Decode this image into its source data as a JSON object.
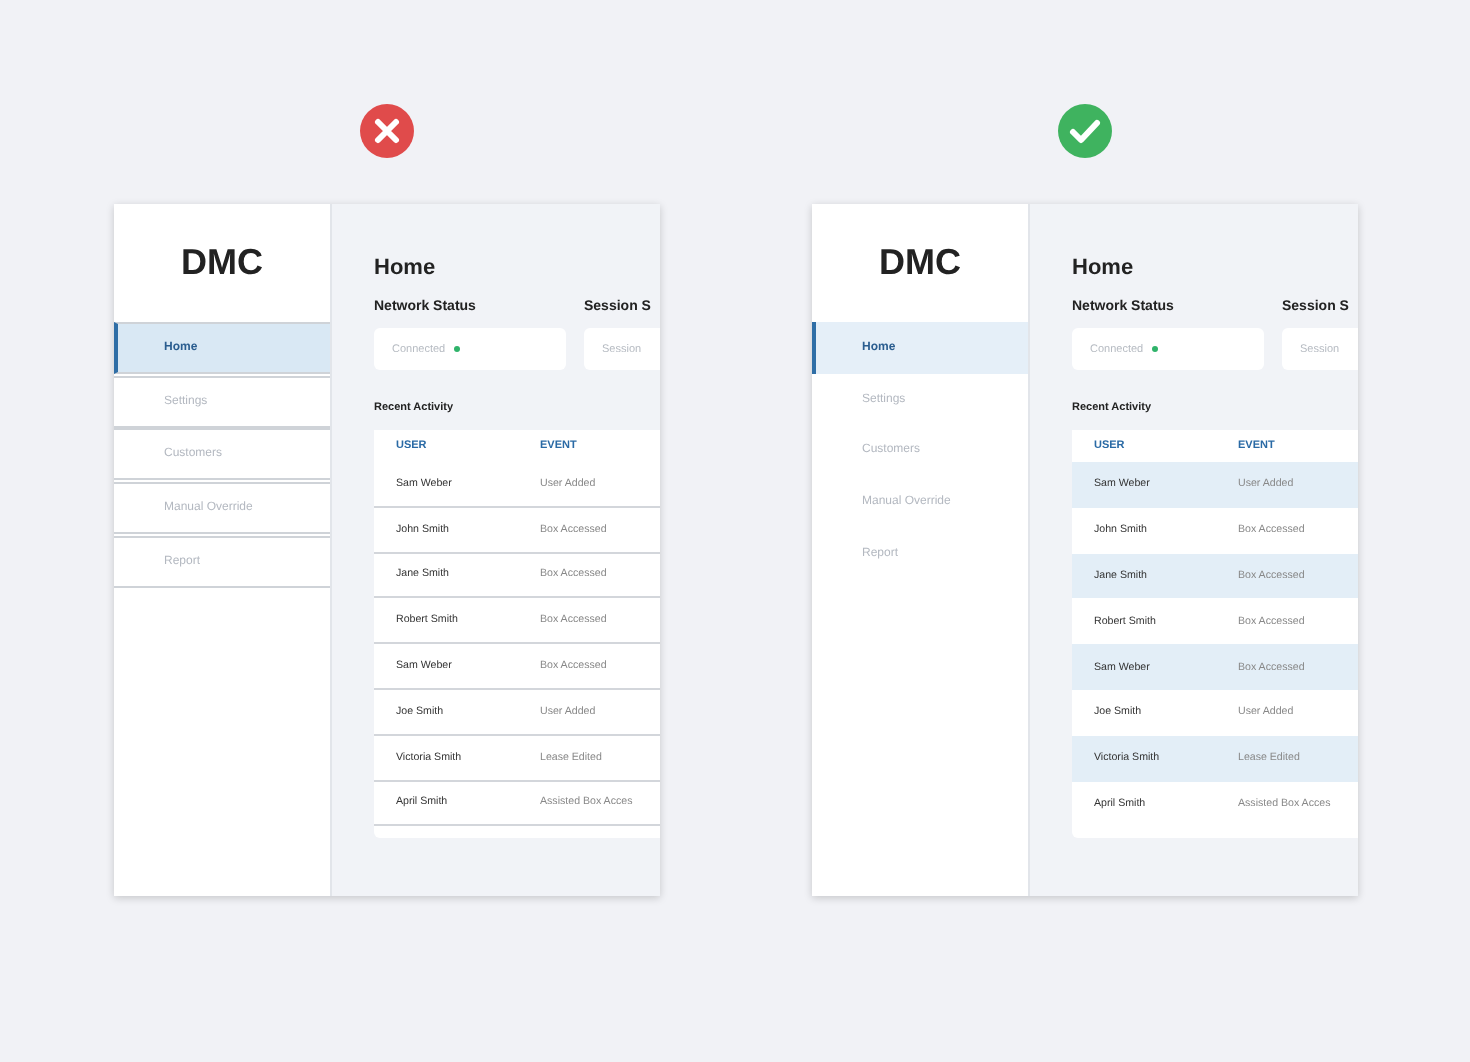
{
  "examples": [
    {
      "kind": "bad",
      "logo": "DMC",
      "nav": [
        {
          "label": "Home",
          "selected": true
        },
        {
          "label": "Settings",
          "selected": false
        },
        {
          "label": "Customers",
          "selected": false
        },
        {
          "label": "Manual Override",
          "selected": false
        },
        {
          "label": "Report",
          "selected": false
        }
      ],
      "title": "Home",
      "statuses": [
        {
          "label": "Network Status",
          "value": "Connected"
        },
        {
          "label": "Session S",
          "value": "Session"
        }
      ],
      "activity": {
        "title": "Recent Activity",
        "columns": [
          "USER",
          "EVENT"
        ],
        "rows": [
          [
            "Sam Weber",
            "User Added"
          ],
          [
            "John Smith",
            "Box Accessed"
          ],
          [
            "Jane Smith",
            "Box Accessed"
          ],
          [
            "Robert Smith",
            "Box Accessed"
          ],
          [
            "Sam Weber",
            "Box Accessed"
          ],
          [
            "Joe Smith",
            "User Added"
          ],
          [
            "Victoria Smith",
            "Lease Edited"
          ],
          [
            "April Smith",
            "Assisted Box Acces"
          ]
        ]
      }
    },
    {
      "kind": "good",
      "logo": "DMC",
      "nav": [
        {
          "label": "Home",
          "selected": true
        },
        {
          "label": "Settings",
          "selected": false
        },
        {
          "label": "Customers",
          "selected": false
        },
        {
          "label": "Manual Override",
          "selected": false
        },
        {
          "label": "Report",
          "selected": false
        }
      ],
      "title": "Home",
      "statuses": [
        {
          "label": "Network Status",
          "value": "Connected"
        },
        {
          "label": "Session S",
          "value": "Session"
        }
      ],
      "activity": {
        "title": "Recent Activity",
        "columns": [
          "USER",
          "EVENT"
        ],
        "rows": [
          [
            "Sam Weber",
            "User Added"
          ],
          [
            "John Smith",
            "Box Accessed"
          ],
          [
            "Jane Smith",
            "Box Accessed"
          ],
          [
            "Robert Smith",
            "Box Accessed"
          ],
          [
            "Sam Weber",
            "Box Accessed"
          ],
          [
            "Joe Smith",
            "User Added"
          ],
          [
            "Victoria Smith",
            "Lease Edited"
          ],
          [
            "April Smith",
            "Assisted Box Acces"
          ]
        ]
      }
    }
  ]
}
